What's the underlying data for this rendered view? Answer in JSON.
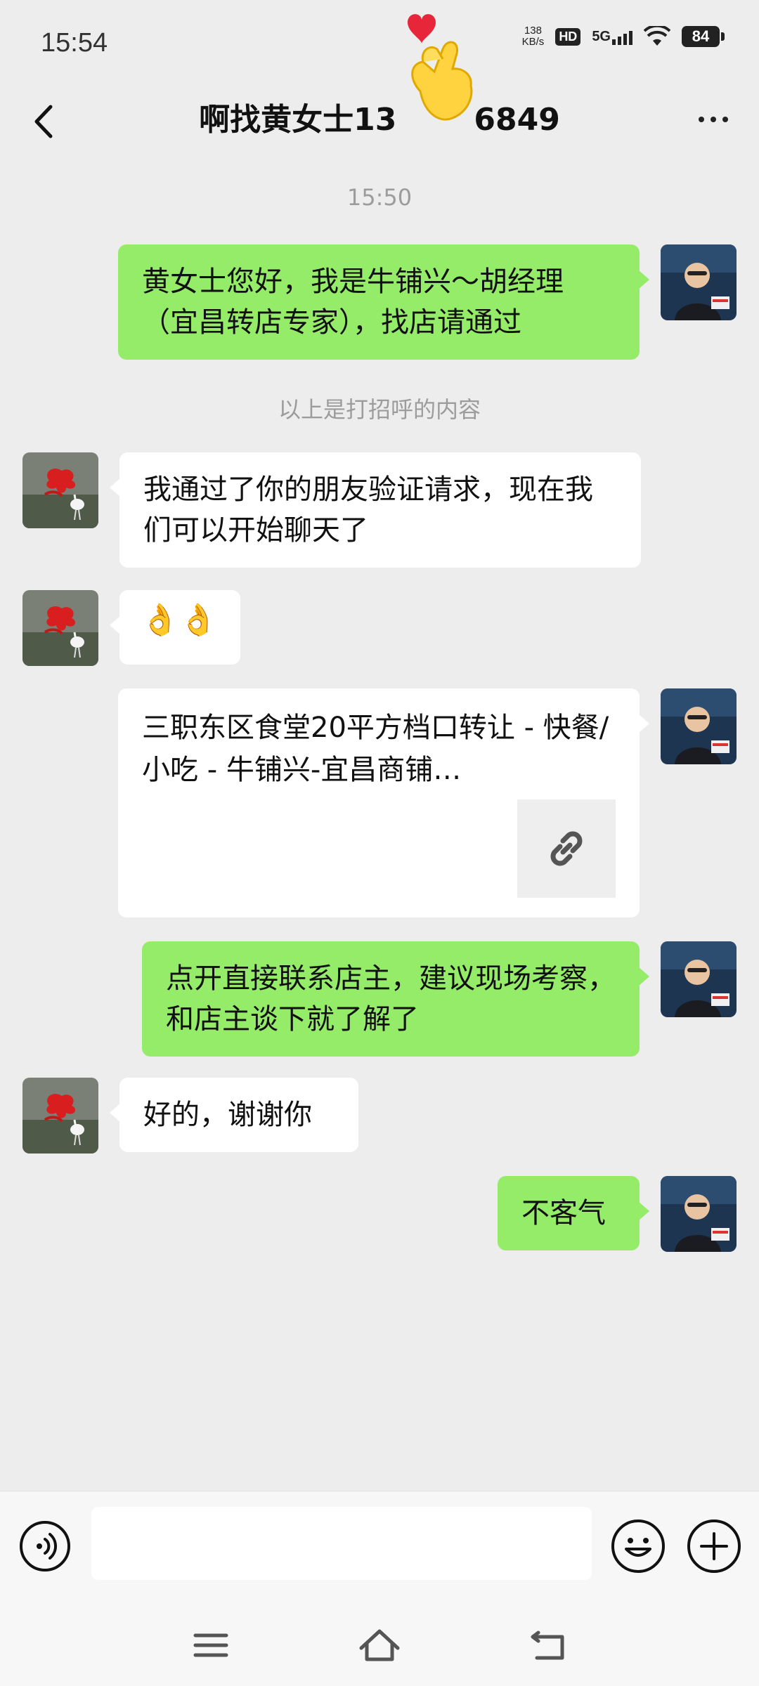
{
  "status_bar": {
    "time": "15:54",
    "net_speed_value": "138",
    "net_speed_unit": "KB/s",
    "hd": "HD",
    "network": "5G",
    "battery": "84"
  },
  "header": {
    "title": "啊找黄女士13",
    "title_tail": "6849",
    "back_icon": "chevron-left-icon",
    "more_icon": "more-dots-icon"
  },
  "chat": {
    "timestamp": "15:50",
    "greeting_notice": "以上是打招呼的内容",
    "messages": [
      {
        "side": "right",
        "type": "text",
        "text": "黄女士您好，我是牛铺兴～胡经理（宜昌转店专家），找店请通过"
      },
      {
        "side": "left",
        "type": "text",
        "text": "我通过了你的朋友验证请求，现在我们可以开始聊天了"
      },
      {
        "side": "left",
        "type": "emoji",
        "text": "👌👌"
      },
      {
        "side": "right",
        "type": "link",
        "text": "三职东区食堂20平方档口转让 - 快餐/小吃 - 牛铺兴-宜昌商铺…",
        "icon": "link-icon"
      },
      {
        "side": "right",
        "type": "text",
        "text": "点开直接联系店主，建议现场考察，和店主谈下就了解了"
      },
      {
        "side": "left",
        "type": "text",
        "text": "好的，谢谢你"
      },
      {
        "side": "right",
        "type": "text",
        "text": "不客气"
      }
    ]
  },
  "input_bar": {
    "voice_icon": "voice-icon",
    "input_value": "",
    "emoji_icon": "emoji-icon",
    "plus_icon": "plus-icon"
  },
  "nav_bar": {
    "menu_icon": "menu-icon",
    "home_icon": "home-icon",
    "back_icon": "back-icon"
  },
  "colors": {
    "background": "#ededed",
    "sent_bubble": "#95ec69",
    "received_bubble": "#ffffff",
    "system_text": "#9c9c9c"
  }
}
